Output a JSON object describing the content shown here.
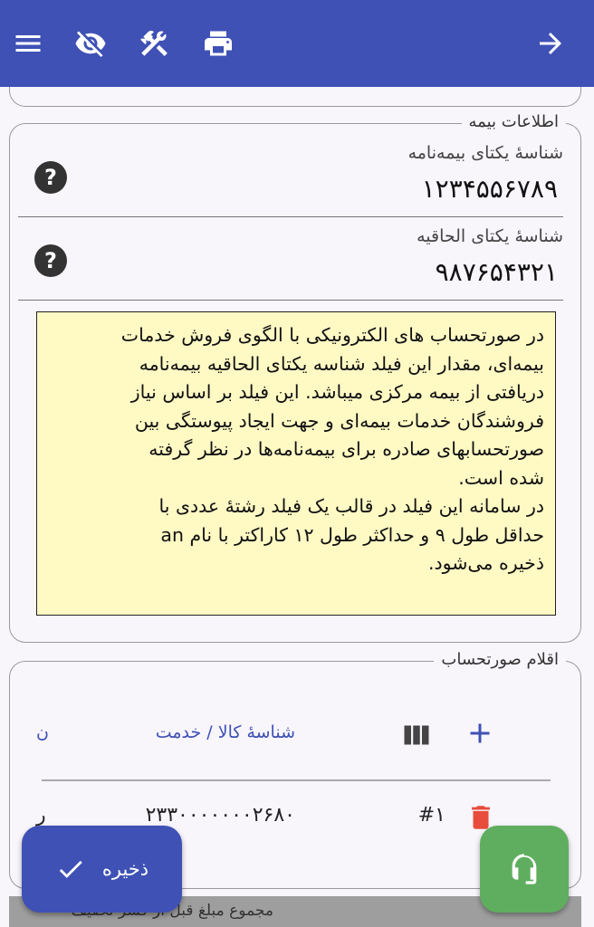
{
  "colors": {
    "primary": "#3f51b5",
    "info_background": "#fff9c4",
    "success": "#5fae5f",
    "danger": "#e74c3c"
  },
  "appbar": {
    "icons": [
      "menu-icon",
      "visibility-off-icon",
      "tools-icon",
      "print-icon",
      "arrow-forward-icon"
    ]
  },
  "insurance": {
    "legend": "اطلاعات بیمه",
    "policy_id": {
      "label": "شناسهٔ یکتای بیمه‌نامه",
      "value": "۱۲۳۴۵۵۶۷۸۹"
    },
    "addendum_id": {
      "label": "شناسهٔ یکتای الحاقیه",
      "value": "۹۸۷۶۵۴۳۲۱"
    },
    "info_lines": [
      "در صورتحساب های الکترونیکی با الگوی فروش خدمات",
      "بیمه‌ای، مقدار این فیلد شناسه یکتای الحاقیه بیمه‌نامه",
      "دریافتی از بیمه مرکزی میباشد. این فیلد بر اساس نیاز",
      "فروشندگان خدمات بیمه‌ای و جهت ایجاد پیوستگی بین",
      "صورتحسابهای صادره برای بیمه‌نامه‌ها در نظر گرفته",
      "شده است.",
      "در سامانه این فیلد در قالب یک فیلد رشتهٔ عددی با",
      "حداقل طول ۹ و حداکثر طول ۱۲ کاراکتر با نام an",
      "ذخیره می‌شود."
    ]
  },
  "items": {
    "legend": "اقلام صورتحساب",
    "column_product_id": "شناسهٔ کالا / خدمت",
    "column_next_partial": "ن",
    "row": {
      "index": "#۱",
      "product_id": "۲۳۳۰۰۰۰۰۰۰۲۶۸۰",
      "next_partial": "ر"
    }
  },
  "total_bar": {
    "text": "مجموع مبلغ قبل از کسر تخفیف"
  },
  "save_button": {
    "label": "ذخیره"
  }
}
